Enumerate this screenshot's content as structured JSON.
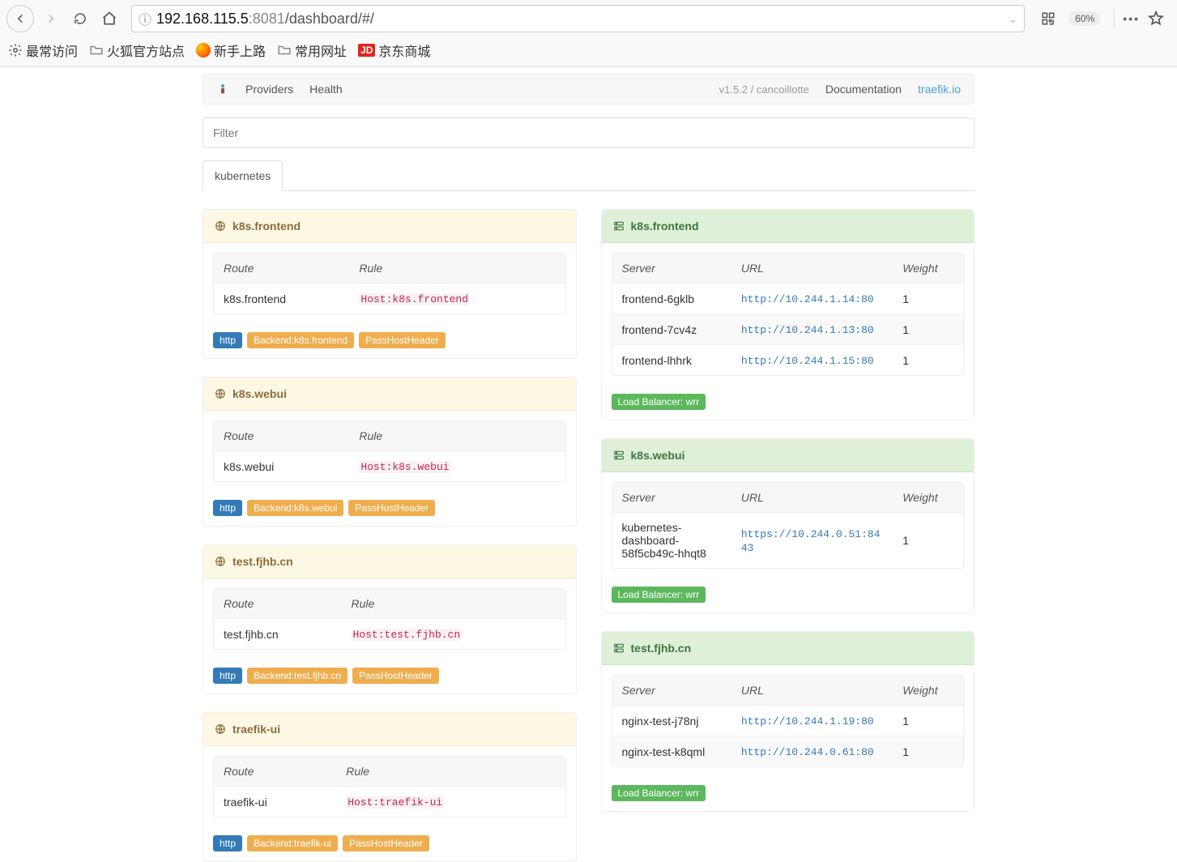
{
  "browser": {
    "url_host": "192.168.115.5",
    "url_port": ":8081",
    "url_path": "/dashboard/#/",
    "zoom": "60%"
  },
  "bookmarks": {
    "most_visited": "最常访问",
    "firefox_official": "火狐官方站点",
    "newbie": "新手上路",
    "common": "常用网址",
    "jd": "京东商城"
  },
  "nav": {
    "providers": "Providers",
    "health": "Health",
    "version": "v1.5.2 / cancoillotte",
    "documentation": "Documentation",
    "site": "traefik.io"
  },
  "filter_placeholder": "Filter",
  "tab": "kubernetes",
  "labels": {
    "route": "Route",
    "rule": "Rule",
    "server": "Server",
    "url": "URL",
    "weight": "Weight"
  },
  "badges": {
    "http": "http",
    "passhost": "PassHostHeader",
    "lb": "Load Balancer: wrr"
  },
  "frontends": [
    {
      "name": "k8s.frontend",
      "route": "k8s.frontend",
      "rule": "Host:k8s.frontend",
      "backend_badge": "Backend:k8s.frontend"
    },
    {
      "name": "k8s.webui",
      "route": "k8s.webui",
      "rule": "Host:k8s.webui",
      "backend_badge": "Backend:k8s.webui"
    },
    {
      "name": "test.fjhb.cn",
      "route": "test.fjhb.cn",
      "rule": "Host:test.fjhb.cn",
      "backend_badge": "Backend:test.fjhb.cn"
    },
    {
      "name": "traefik-ui",
      "route": "traefik-ui",
      "rule": "Host:traefik-ui",
      "backend_badge": "Backend:traefik-ui"
    }
  ],
  "backends": [
    {
      "name": "k8s.frontend",
      "servers": [
        {
          "server": "frontend-6gklb",
          "url": "http://10.244.1.14:80",
          "weight": "1"
        },
        {
          "server": "frontend-7cv4z",
          "url": "http://10.244.1.13:80",
          "weight": "1"
        },
        {
          "server": "frontend-lhhrk",
          "url": "http://10.244.1.15:80",
          "weight": "1"
        }
      ]
    },
    {
      "name": "k8s.webui",
      "servers": [
        {
          "server": "kubernetes-dashboard-58f5cb49c-hhqt8",
          "url": "https://10.244.0.51:8443",
          "weight": "1"
        }
      ]
    },
    {
      "name": "test.fjhb.cn",
      "servers": [
        {
          "server": "nginx-test-j78nj",
          "url": "http://10.244.1.19:80",
          "weight": "1"
        },
        {
          "server": "nginx-test-k8qml",
          "url": "http://10.244.0.61:80",
          "weight": "1"
        }
      ]
    }
  ]
}
